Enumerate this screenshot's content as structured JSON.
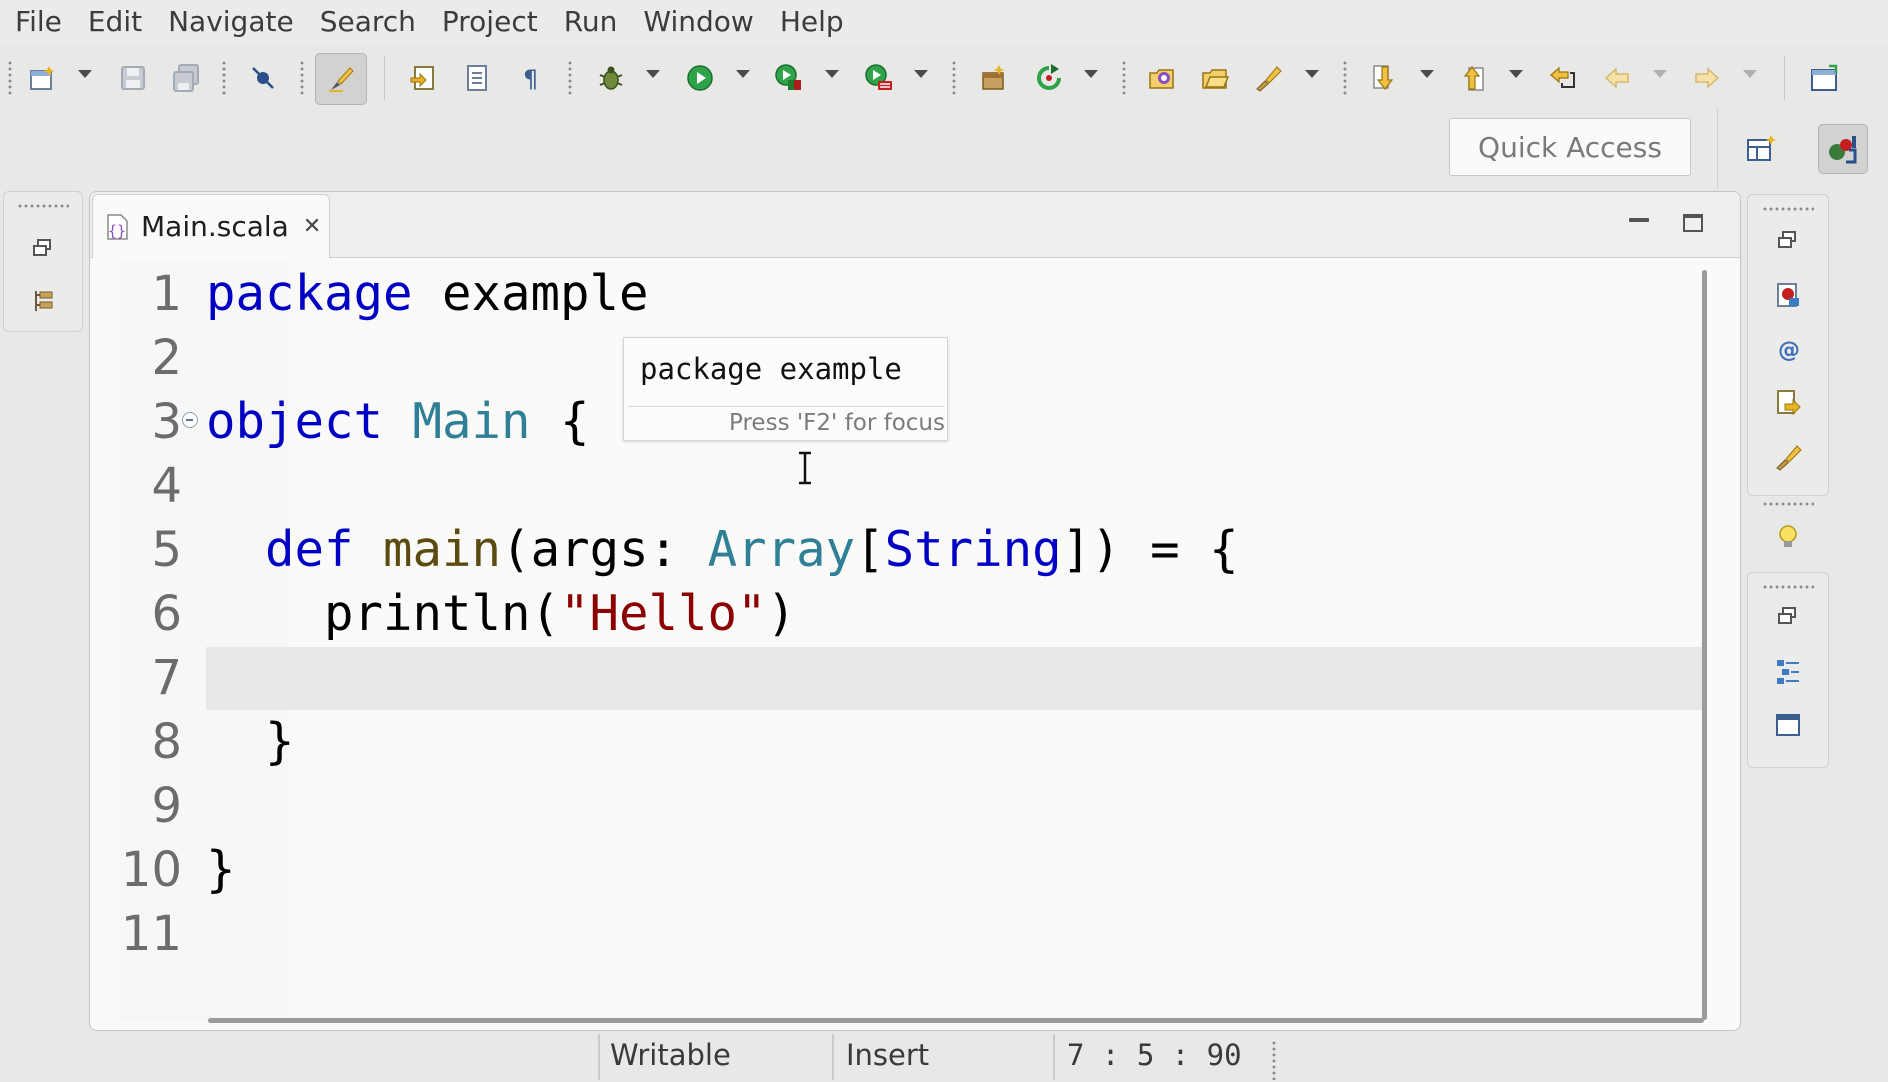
{
  "menubar": {
    "items": [
      "File",
      "Edit",
      "Navigate",
      "Search",
      "Project",
      "Run",
      "Window",
      "Help"
    ]
  },
  "toolbar": {
    "buttons": [
      "new-wizard-icon",
      "save-icon",
      "save-all-icon",
      "skip-breakpoints-icon",
      "mark-occurrences-icon",
      "open-type-icon",
      "open-resource-icon",
      "show-whitespace-icon",
      "debug-icon",
      "run-icon",
      "run-coverage-icon",
      "external-tools-icon",
      "new-scala-project-icon",
      "refresh-icon",
      "new-package-icon",
      "new-folder-icon",
      "search-icon",
      "next-annotation-icon",
      "previous-annotation-icon",
      "last-edit-location-icon",
      "back-icon",
      "forward-icon",
      "open-perspective-icon"
    ]
  },
  "quick_access": {
    "placeholder": "Quick Access"
  },
  "perspectives": [
    "open-perspective-icon",
    "scala-perspective-icon"
  ],
  "editor": {
    "tab_label": "Main.scala",
    "line_numbers": [
      "1",
      "2",
      "3",
      "4",
      "5",
      "6",
      "7",
      "8",
      "9",
      "10",
      "11"
    ],
    "current_line": 7,
    "hover": {
      "text": "package example",
      "hint": "Press 'F2' for focus"
    }
  },
  "statusbar": {
    "writable": "Writable",
    "insert_mode": "Insert",
    "position": "7 : 5 : 90"
  },
  "colors": {
    "keyword": "#0000c4",
    "class_name": "#2f7f96",
    "method_name": "#5b4b10",
    "string": "#8b0000",
    "current_line": "#e8e8e7"
  }
}
